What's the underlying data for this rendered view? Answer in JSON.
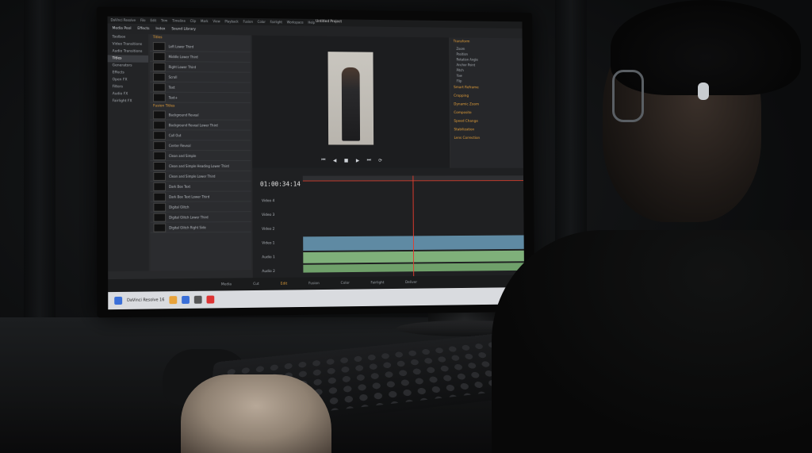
{
  "scene": {
    "description_labels": []
  },
  "app": {
    "menubar": [
      "DaVinci Resolve",
      "File",
      "Edit",
      "Trim",
      "Timeline",
      "Clip",
      "Mark",
      "View",
      "Playback",
      "Fusion",
      "Color",
      "Fairlight",
      "Workspace",
      "Help"
    ],
    "project_title": "Untitled Project",
    "toolbar": [
      "Media Pool",
      "Effects",
      "Index",
      "Sound Library"
    ],
    "effects_categories": [
      "Toolbox",
      "Video Transitions",
      "Audio Transitions",
      "Titles",
      "Generators",
      "Effects",
      "Open FX",
      "Filters",
      "Audio FX",
      "Fairlight FX"
    ],
    "titles_header": "Titles",
    "titles": [
      "Left Lower Third",
      "Middle Lower Third",
      "Right Lower Third",
      "Scroll",
      "Text",
      "Text+",
      "Fusion Titles",
      "Background Reveal",
      "Background Reveal Lower Third",
      "Call Out",
      "Center Reveal",
      "Clean and Simple",
      "Clean and Simple Heading Lower Third",
      "Clean and Simple Lower Third",
      "Dark Box Text",
      "Dark Box Text Lower Third",
      "Digital Glitch",
      "Digital Glitch Lower Third",
      "Digital Glitch Right Side"
    ],
    "inspector": {
      "section1": "Transform",
      "fields": [
        "Zoom",
        "Position",
        "Rotation Angle",
        "Anchor Point",
        "Pitch",
        "Yaw",
        "Flip"
      ],
      "sections": [
        "Smart Reframe",
        "Cropping",
        "Dynamic Zoom",
        "Composite",
        "Speed Change",
        "Stabilization",
        "Lens Correction"
      ]
    },
    "timecode": "01:00:34:14",
    "tracks": [
      "Video 4",
      "Video 3",
      "Video 2",
      "Video 1",
      "Audio 1",
      "Audio 2"
    ],
    "pages": [
      "Media",
      "Cut",
      "Edit",
      "Fusion",
      "Color",
      "Fairlight",
      "Deliver"
    ],
    "active_page": "Edit",
    "taskbar_app": "DaVinci Resolve 16"
  }
}
